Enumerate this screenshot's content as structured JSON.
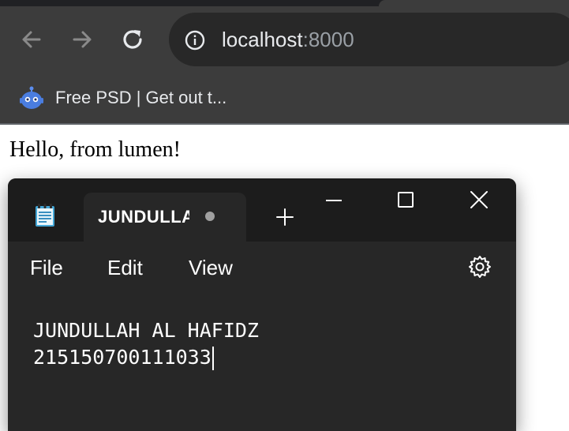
{
  "browser": {
    "url_host": "localhost",
    "url_port": ":8000",
    "bookmark_label": "Free PSD | Get out t..."
  },
  "page": {
    "text": "Hello, from lumen!"
  },
  "notepad": {
    "tab_title": "JUNDULLAH AL HAFIDZ",
    "menu": [
      "File",
      "Edit",
      "View"
    ],
    "lines": [
      "JUNDULLAH AL HAFIDZ",
      "215150700111033"
    ]
  }
}
